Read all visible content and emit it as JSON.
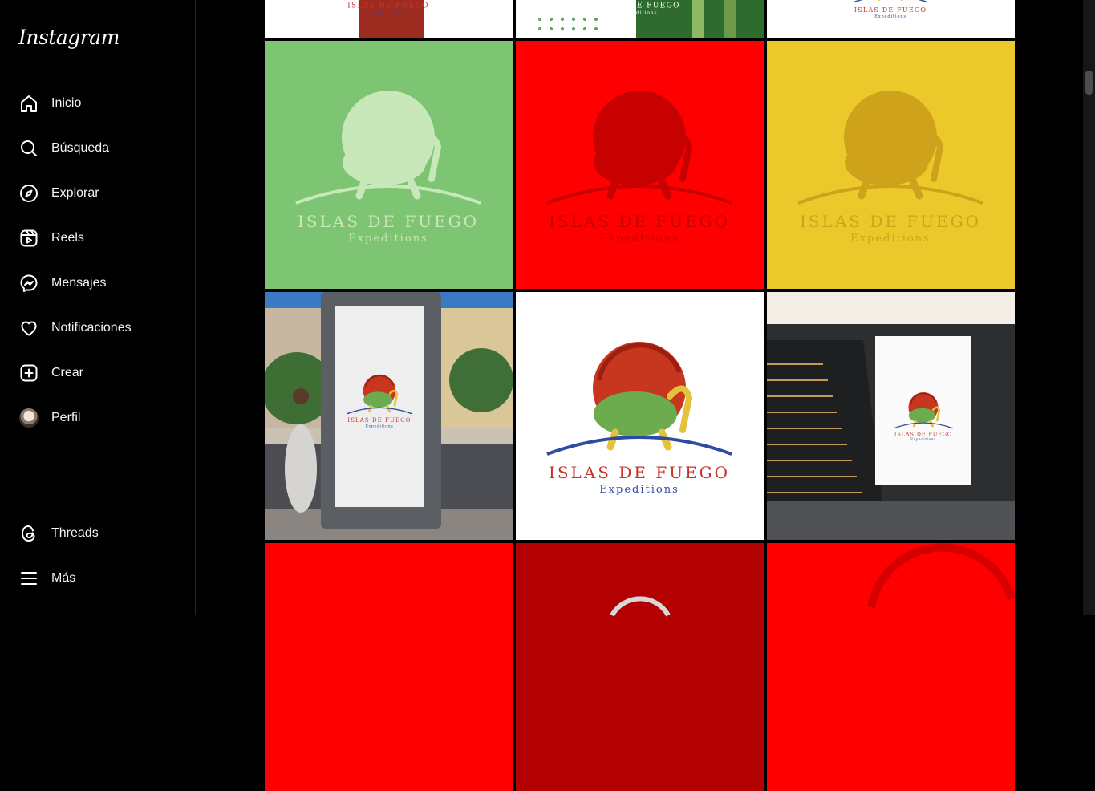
{
  "app": {
    "logo_text": "Instagram"
  },
  "nav": [
    {
      "label": "Inicio",
      "icon": "home-icon"
    },
    {
      "label": "Búsqueda",
      "icon": "search-icon"
    },
    {
      "label": "Explorar",
      "icon": "compass-icon"
    },
    {
      "label": "Reels",
      "icon": "reels-icon"
    },
    {
      "label": "Mensajes",
      "icon": "messenger-icon"
    },
    {
      "label": "Notificaciones",
      "icon": "heart-icon"
    },
    {
      "label": "Crear",
      "icon": "plus-square-icon"
    },
    {
      "label": "Perfil",
      "icon": "avatar"
    }
  ],
  "nav_bottom": [
    {
      "label": "Threads",
      "icon": "threads-icon"
    },
    {
      "label": "Más",
      "icon": "menu-icon"
    }
  ],
  "posts": {
    "brand_title": "Islas de Fuego",
    "brand_subtitle": "Expeditions",
    "row1": [
      {
        "bg": "#ffffff"
      },
      {
        "bg": "#2e6b2e"
      },
      {
        "bg": "#ffffff"
      }
    ],
    "row2": [
      {
        "bg": "#7dc573"
      },
      {
        "bg": "#fe0000"
      },
      {
        "bg": "#ecc92a"
      }
    ],
    "row3": [
      {
        "kind": "street-billboard"
      },
      {
        "bg": "#ffffff"
      },
      {
        "kind": "subway-billboard"
      }
    ],
    "row4": [
      {
        "bg": "#fe0000"
      },
      {
        "bg": "#b30000"
      },
      {
        "bg": "#fe0000"
      }
    ]
  },
  "colors": {
    "sidebar_bg": "#000000",
    "border": "#262626"
  }
}
